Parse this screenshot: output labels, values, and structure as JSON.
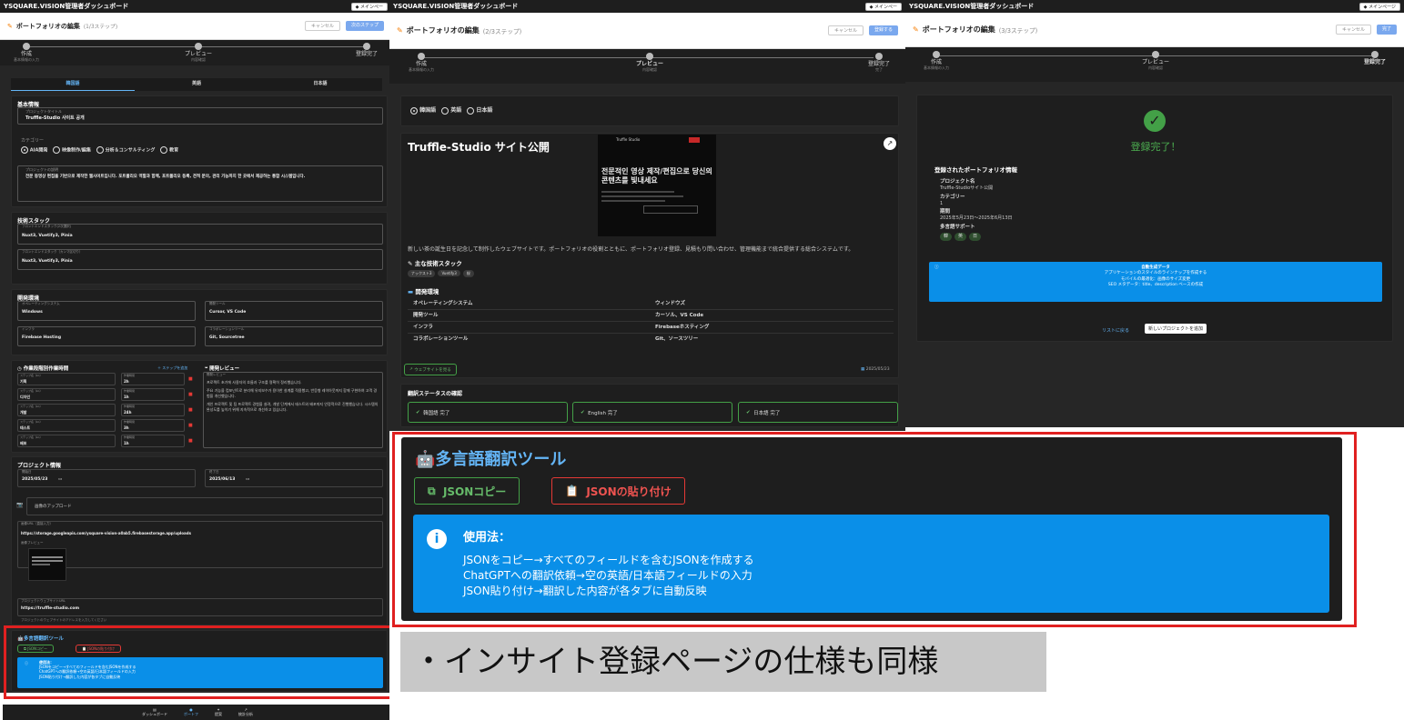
{
  "panel1": {
    "window_title": "YSQUARE.VISION管理者ダッシュボード",
    "menu_pill": "◆ メインペー",
    "header_title": "ポートフォリオの編集",
    "header_sub": "(1/3ステップ)",
    "cancel": "キャンセル",
    "next": "次のステップ",
    "steps": [
      {
        "label": "作成",
        "sub": "基本情報の入力"
      },
      {
        "label": "プレビュー",
        "sub": "内容確認"
      },
      {
        "label": "登録完了",
        "sub": ""
      }
    ],
    "lang_tabs": [
      "韓国語",
      "英語",
      "日本語"
    ],
    "basic": {
      "title": "基本情報",
      "project_title_label": "プロジェクトタイトル",
      "project_title_value": "Truffle-Studio 사이트 공개",
      "category_label": "カテゴリー",
      "categories": [
        "AIA開発",
        "映像制作/編集",
        "分析＆コンサルティング",
        "教育"
      ],
      "desc_label": "プロジェクトの説明",
      "desc_value": "전문 동영상 편집을 기반으로 제작한 웹사이트입니다. 포트폴리오 역할과 함께, 포트폴리오 등록, 견적 문의, 관리 기능까지 한 곳에서 제공하는 통합 시스템입니다."
    },
    "tech": {
      "title": "技術スタック",
      "front_label": "フロントエンドスタック(2次選択)",
      "front_value": "Nuxt3, Vuetify3, Pinia",
      "back_label": "フロントエンドスタック（カンマ区切り）",
      "back_value": "Nuxt3, Vuetify3, Pinia"
    },
    "env": {
      "title": "開発環境",
      "os_label": "オペレーティングシステム",
      "os_value": "Windows",
      "tool_label": "開発ツール",
      "tool_value": "Cursor, VS Code",
      "infra_label": "インフラ",
      "infra_value": "Firebase Hosting",
      "collab_label": "コラボレーションツール",
      "collab_value": "Git, Sourcetree"
    },
    "work": {
      "title": "作業段階別作業時間",
      "add": "＋ ステップを追加",
      "steps": [
        {
          "label": "ステップ名（ko）",
          "name": "기획",
          "hours": "2h"
        },
        {
          "label": "ステップ名（ko）",
          "name": "디자인",
          "hours": "1h"
        },
        {
          "label": "ステップ名（ko）",
          "name": "개발",
          "hours": "24h"
        },
        {
          "label": "ステップ名（ko）",
          "name": "테스트",
          "hours": "3h"
        },
        {
          "label": "ステップ名（ko）",
          "name": "배포",
          "hours": "1h"
        }
      ],
      "hours_label": "作業時間"
    },
    "review": {
      "title": "開発レビュー",
      "label": "開発レビュー",
      "p1": "프로젝트 초기에 사용자의 흐름과 구조를 명확히 정리했습니다.",
      "p2": "주요 기능을 컴포넌트로 분리해 유지보수가 용이한 설계를 적용했고, 반응형 레이아웃까지 함께 구현하여 고객 경험을 개선했습니다.",
      "p3": "개인 프로젝트 및 팀 프로젝트 경험을 살려, 개발 단계에서 테스트와 배포까지 안정적으로 진행했습니다. 시스템의 완성도를 높이기 위해 지속적으로 개선하고 있습니다."
    },
    "projinfo": {
      "title": "プロジェクト情報",
      "start_label": "開始日",
      "start_value": "2025/05/23",
      "end_label": "終了日",
      "end_value": "2025/06/13",
      "upload": "画像のアップロード",
      "url_label": "画像URL（直接入力）",
      "url_value": "https://storage.googleapis.com/ysquare-vision-a0ab5.firebasestorage.app/uploads",
      "preview_label": "画像プレビュー",
      "site_label": "プロジェクトウェブサイトURL",
      "site_value": "https://truffle-studio.com",
      "site_help": "プロジェクトのウェブサイトのアドレスを入力してください"
    },
    "tool": {
      "title": "多言語翻訳ツール",
      "copy": "JSONコピー",
      "paste": "JSONの貼り付け",
      "usage": "使用法：",
      "l1": "JSONをコピー→すべてのフィールドを含むJSONを作成する",
      "l2": "ChatGPTへの翻訳依頼→空の英語/日本語フィールドの入力",
      "l3": "JSON貼り付け→翻訳した内容が各タブに自動反映"
    },
    "bottom_nav": [
      "ダッシュボード",
      "ポートフ",
      "提案",
      "統計分析"
    ]
  },
  "panel2": {
    "window_title": "YSQUARE.VISION管理者ダッシュボード",
    "menu_pill": "◆ メインペー",
    "header_title": "ポートフォリオの編集",
    "header_sub": "(2/3ステップ)",
    "cancel": "キャンセル",
    "next": "登録する",
    "steps": [
      {
        "label": "作成",
        "sub": "基本情報の入力"
      },
      {
        "label": "プレビュー",
        "sub": "内容確認"
      },
      {
        "label": "登録完了",
        "sub": "完了"
      }
    ],
    "langs": [
      "韓国語",
      "英語",
      "日本語"
    ],
    "card_title": "Truffle-Studio サイト公開",
    "hero_brand": "Truffle Studio",
    "hero_headline": "전문적인 영상 제작/편집으로 당신의 콘텐츠를 빛내세요",
    "desc": "新しい茶の誕生日を記念して制作したウェブサイトです。ポートフォリオの役割とともに、ポートフォリオ登録、見積もり問い合わせ、管理機能まで統合提供する総合システムです。",
    "tech_title": "主な技術スタック",
    "tech_tags": [
      "ナックスト3",
      "Vuetify3",
      "桜"
    ],
    "env_title": "開発環境",
    "env_rows": [
      [
        "オペレーティングシステム",
        "ウィンドウズ"
      ],
      [
        "開発ツール",
        "カーソル、VS Code"
      ],
      [
        "インフラ",
        "Firebaseホスティング"
      ],
      [
        "コラボレーションツール",
        "Git、ソースツリー"
      ]
    ],
    "visit": "ウェブサイトを見る",
    "date": "2025/05/23",
    "status_title": "翻訳ステータスの確認",
    "status": [
      "韓国語 完了",
      "English 完了",
      "日本語 完了"
    ],
    "tool": {
      "title": "多言語翻訳ツール",
      "copy": "JSONコピー",
      "paste": "JSONの貼り付け",
      "usage": "使用法：",
      "l1": "JSONをコピー→すべてのフィールドを含むJSONを作成する",
      "l2": "ChatGPTへの翻訳依頼→空の英語/日本語フィールドの入力",
      "l3": "JSON貼り付け→翻訳した内容が各タブに自動反映"
    }
  },
  "panel3": {
    "window_title": "YSQUARE.VISION管理者ダッシュボード",
    "menu_pill": "◆ メインページ",
    "header_title": "ポートフォリオの編集",
    "header_sub": "(3/3ステップ)",
    "cancel": "キャンセル",
    "next": "完了",
    "steps": [
      {
        "label": "作成",
        "sub": "基本情報の入力"
      },
      {
        "label": "プレビュー",
        "sub": "内容確認"
      },
      {
        "label": "登録完了",
        "sub": ""
      }
    ],
    "done": "登録完了！",
    "info_title": "登録されたポートフォリオ情報",
    "proj_label": "プロジェクト名",
    "proj_value": "Truffle-Studioサイト公開",
    "cat_label": "カテゴリー",
    "cat_value": "1",
    "period_label": "期間",
    "period_value": "2025年5月23日〜2025年6月13日",
    "lang_label": "多言語サポート",
    "lang_tags": [
      "韓",
      "英",
      "日"
    ],
    "auto_title": "自動生成データ",
    "auto_l1": "アプリケーションのスタイルのラインナップを作成する",
    "auto_l2": "モバイルの最適化：画像のサイズ変更",
    "auto_l3": "SEO メタデータ：title、description ベースの作成",
    "back": "リストに戻る",
    "new": "新しいプロジェクトを追加"
  },
  "note": "・インサイト登録ページの仕様も同様"
}
